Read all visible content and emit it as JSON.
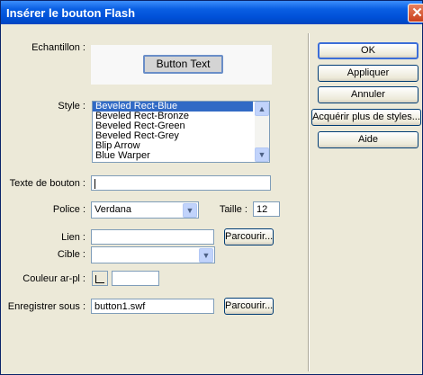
{
  "window": {
    "title": "Insérer le bouton Flash",
    "close_glyph": "✕"
  },
  "form": {
    "sample_label": "Echantillon :",
    "sample_button_text": "Button Text",
    "style_label": "Style :",
    "styles": [
      "Beveled Rect-Blue",
      "Beveled Rect-Bronze",
      "Beveled Rect-Green",
      "Beveled Rect-Grey",
      "Blip Arrow",
      "Blue Warper"
    ],
    "selected_style": "Beveled Rect-Blue",
    "button_text_label": "Texte de bouton :",
    "button_text_value": "",
    "font_label": "Police :",
    "font_value": "Verdana",
    "size_label": "Taille :",
    "size_value": "12",
    "link_label": "Lien :",
    "link_value": "",
    "browse_label": "Parcourir...",
    "target_label": "Cible :",
    "target_value": "",
    "bgcolor_label": "Couleur ar-pl :",
    "bgcolor_value": "",
    "save_as_label": "Enregistrer sous :",
    "save_as_value": "button1.swf"
  },
  "actions": {
    "ok": "OK",
    "apply": "Appliquer",
    "cancel": "Annuler",
    "more_styles": "Acquérir plus de styles...",
    "help": "Aide"
  }
}
